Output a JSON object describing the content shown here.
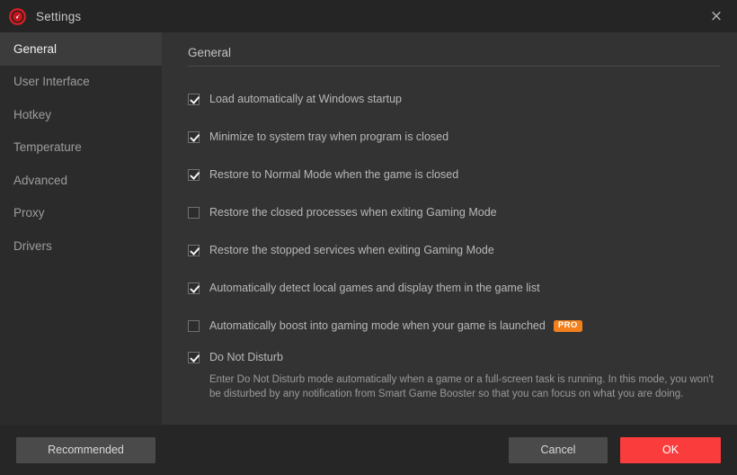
{
  "window": {
    "title": "Settings",
    "logo_icon": "speedometer-gauge-icon",
    "close_icon": "×"
  },
  "sidebar": {
    "items": [
      {
        "label": "General",
        "active": true
      },
      {
        "label": "User Interface",
        "active": false
      },
      {
        "label": "Hotkey",
        "active": false
      },
      {
        "label": "Temperature",
        "active": false
      },
      {
        "label": "Advanced",
        "active": false
      },
      {
        "label": "Proxy",
        "active": false
      },
      {
        "label": "Drivers",
        "active": false
      }
    ]
  },
  "content": {
    "section_title": "General",
    "options": [
      {
        "label": "Load automatically at Windows startup",
        "checked": true,
        "pro": false
      },
      {
        "label": "Minimize to system tray when program is closed",
        "checked": true,
        "pro": false
      },
      {
        "label": "Restore to Normal Mode when the game is closed",
        "checked": true,
        "pro": false
      },
      {
        "label": "Restore the closed processes when exiting Gaming Mode",
        "checked": false,
        "pro": false
      },
      {
        "label": "Restore the stopped services when exiting Gaming Mode",
        "checked": true,
        "pro": false
      },
      {
        "label": "Automatically detect local games and display them in the game list",
        "checked": true,
        "pro": false
      },
      {
        "label": "Automatically boost into gaming mode when your game is launched",
        "checked": false,
        "pro": true,
        "pro_label": "PRO"
      }
    ],
    "do_not_disturb": {
      "label": "Do Not Disturb",
      "checked": true,
      "description": "Enter Do Not Disturb mode automatically when a game or a full-screen task is running. In this mode, you won't be disturbed by any notification from Smart Game Booster so that you can focus on what you are doing."
    }
  },
  "footer": {
    "recommended_label": "Recommended",
    "cancel_label": "Cancel",
    "ok_label": "OK"
  },
  "colors": {
    "accent_red": "#fa3c3c",
    "pro_orange": "#f3801d",
    "sidebar_bg": "#2b2b2b",
    "content_bg": "#333333",
    "titlebar_bg": "#252525",
    "footer_bg": "#262626"
  }
}
